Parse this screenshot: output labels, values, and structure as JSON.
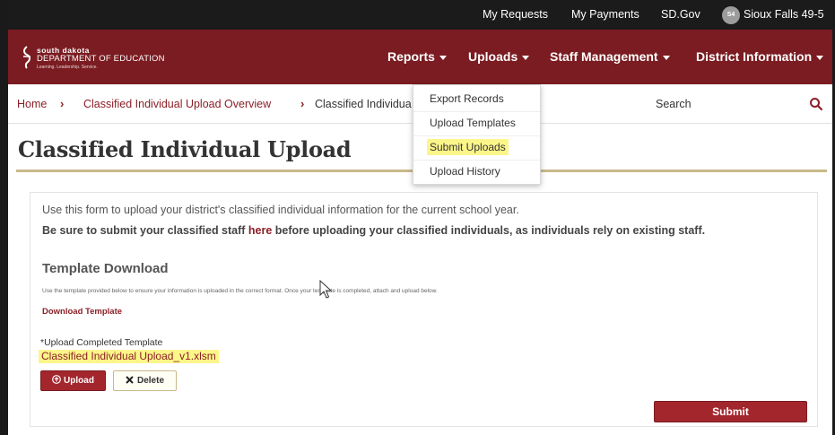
{
  "topbar": {
    "my_requests": "My Requests",
    "my_payments": "My Payments",
    "sd_gov": "SD.Gov",
    "avatar_initials": "S4",
    "user_name": "Sioux Falls 49-5"
  },
  "header": {
    "logo_line1": "south dakota",
    "logo_line2": "DEPARTMENT OF EDUCATION",
    "logo_line3": "Learning. Leadership. Service.",
    "nav": {
      "reports": "Reports",
      "uploads": "Uploads",
      "staff_management": "Staff Management",
      "district_information": "District Information"
    }
  },
  "breadcrumb": {
    "home": "Home",
    "overview": "Classified Individual Upload Overview",
    "current": "Classified Individua"
  },
  "search": {
    "placeholder": "Search"
  },
  "uploads_menu": {
    "items": [
      "Export Records",
      "Upload Templates",
      "Submit Uploads",
      "Upload History"
    ],
    "highlighted": "Submit Uploads"
  },
  "page": {
    "title": "Classified Individual Upload",
    "intro": "Use this form to upload your district's classified individual information for the current school year.",
    "note_before": "Be sure to submit your classified staff ",
    "note_link": "here",
    "note_after": " before uploading your classified individuals, as individuals rely on existing staff.",
    "section_title": "Template Download",
    "section_note": "Use the template provided below to ensure your information is uploaded in the correct format. Once your template is completed, attach and upload below.",
    "download_link": "Download Template",
    "upload_label": "Upload Completed Template",
    "required_mark": "*",
    "file_name": "Classified Individual Upload_v1.xlsm",
    "upload_button": "Upload",
    "delete_button": "Delete",
    "submit_button": "Submit"
  },
  "colors": {
    "brand_maroon": "#7a1c21",
    "button_red": "#a3262d",
    "link_maroon": "#8a1f26",
    "gold_rule": "#c9b98a",
    "highlight": "#fcf68a"
  }
}
